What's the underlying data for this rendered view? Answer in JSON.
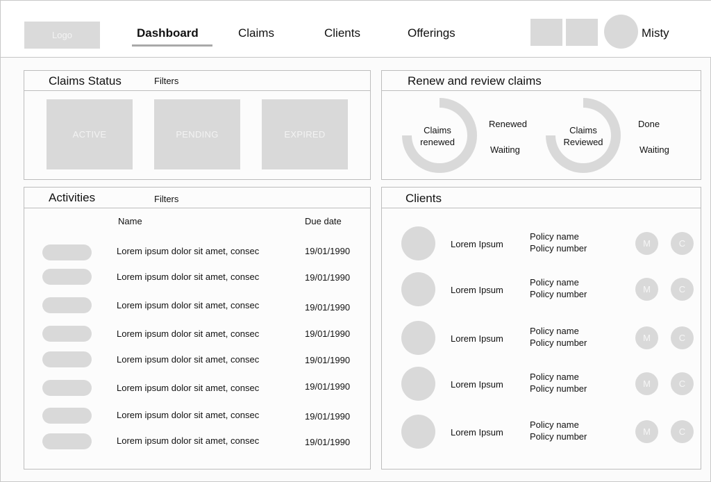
{
  "header": {
    "logo": "Logo",
    "tabs": [
      {
        "label": "Dashboard"
      },
      {
        "label": "Claims"
      },
      {
        "label": "Clients"
      },
      {
        "label": "Offerings"
      }
    ],
    "username": "Misty"
  },
  "claims_status": {
    "title": "Claims Status",
    "filters": "Filters",
    "boxes": [
      "ACTIVE",
      "PENDING",
      "EXPIRED"
    ]
  },
  "renew_review": {
    "title": "Renew and review claims",
    "donuts": [
      {
        "label_line1": "Claims",
        "label_line2": "renewed",
        "legend": [
          "Renewed",
          "Waiting"
        ],
        "fraction": 0.75
      },
      {
        "label_line1": "Claims",
        "label_line2": "Reviewed",
        "legend": [
          "Done",
          "Waiting"
        ],
        "fraction": 0.75
      }
    ]
  },
  "activities": {
    "title": "Activities",
    "filters": "Filters",
    "columns": {
      "name": "Name",
      "due": "Due date"
    },
    "rows": [
      {
        "name": "Lorem ipsum dolor sit amet, consec",
        "due": "19/01/1990"
      },
      {
        "name": "Lorem ipsum dolor sit amet, consec",
        "due": "19/01/1990"
      },
      {
        "name": "Lorem ipsum dolor sit amet, consec",
        "due": "19/01/1990"
      },
      {
        "name": "Lorem ipsum dolor sit amet, consec",
        "due": "19/01/1990"
      },
      {
        "name": "Lorem ipsum dolor sit amet, consec",
        "due": "19/01/1990"
      },
      {
        "name": "Lorem ipsum dolor sit amet, consec",
        "due": "19/01/1990"
      },
      {
        "name": "Lorem ipsum dolor sit amet, consec",
        "due": "19/01/1990"
      },
      {
        "name": "Lorem ipsum dolor sit amet, consec",
        "due": "19/01/1990"
      }
    ]
  },
  "clients": {
    "title": "Clients",
    "rows": [
      {
        "name": "Lorem Ipsum",
        "policy_name": "Policy name",
        "policy_number": "Policy number",
        "btn_m": "M",
        "btn_c": "C"
      },
      {
        "name": "Lorem Ipsum",
        "policy_name": "Policy name",
        "policy_number": "Policy number",
        "btn_m": "M",
        "btn_c": "C"
      },
      {
        "name": "Lorem Ipsum",
        "policy_name": "Policy name",
        "policy_number": "Policy number",
        "btn_m": "M",
        "btn_c": "C"
      },
      {
        "name": "Lorem Ipsum",
        "policy_name": "Policy name",
        "policy_number": "Policy number",
        "btn_m": "M",
        "btn_c": "C"
      },
      {
        "name": "Lorem Ipsum",
        "policy_name": "Policy name",
        "policy_number": "Policy number",
        "btn_m": "M",
        "btn_c": "C"
      }
    ]
  },
  "colors": {
    "placeholder": "#d9d9d9",
    "border": "#bdbdbd",
    "underline": "#a9a9a9"
  }
}
